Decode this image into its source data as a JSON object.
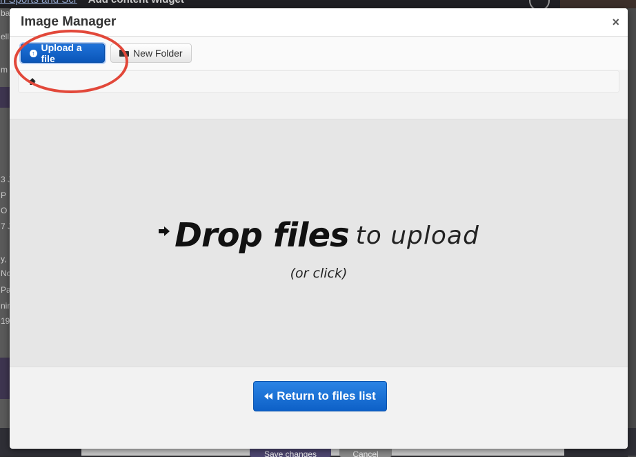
{
  "background": {
    "title_link": "n Sports and Scr",
    "title": "Add content widget",
    "left_fragments": [
      "ba",
      "ell",
      "m",
      "3 J",
      "P",
      "O",
      "7 J",
      "y,",
      "No",
      "Pa",
      "nin",
      "19"
    ],
    "save_label": "Save changes",
    "cancel_label": "Cancel"
  },
  "modal": {
    "title": "Image Manager",
    "close_glyph": "×"
  },
  "toolbar": {
    "upload_label": "Upload a file",
    "new_folder_label": "New Folder"
  },
  "dropzone": {
    "strong": "Drop files",
    "light": "to upload",
    "sub": "(or click)"
  },
  "footer": {
    "return_label": "Return to files list"
  },
  "colors": {
    "primary_blue": "#0d60c7",
    "annotation_red": "#e2483a"
  },
  "icons": [
    "upload-icon",
    "folder-open-icon",
    "home-icon",
    "arrow-right-icon",
    "backward-icon",
    "close-icon"
  ]
}
